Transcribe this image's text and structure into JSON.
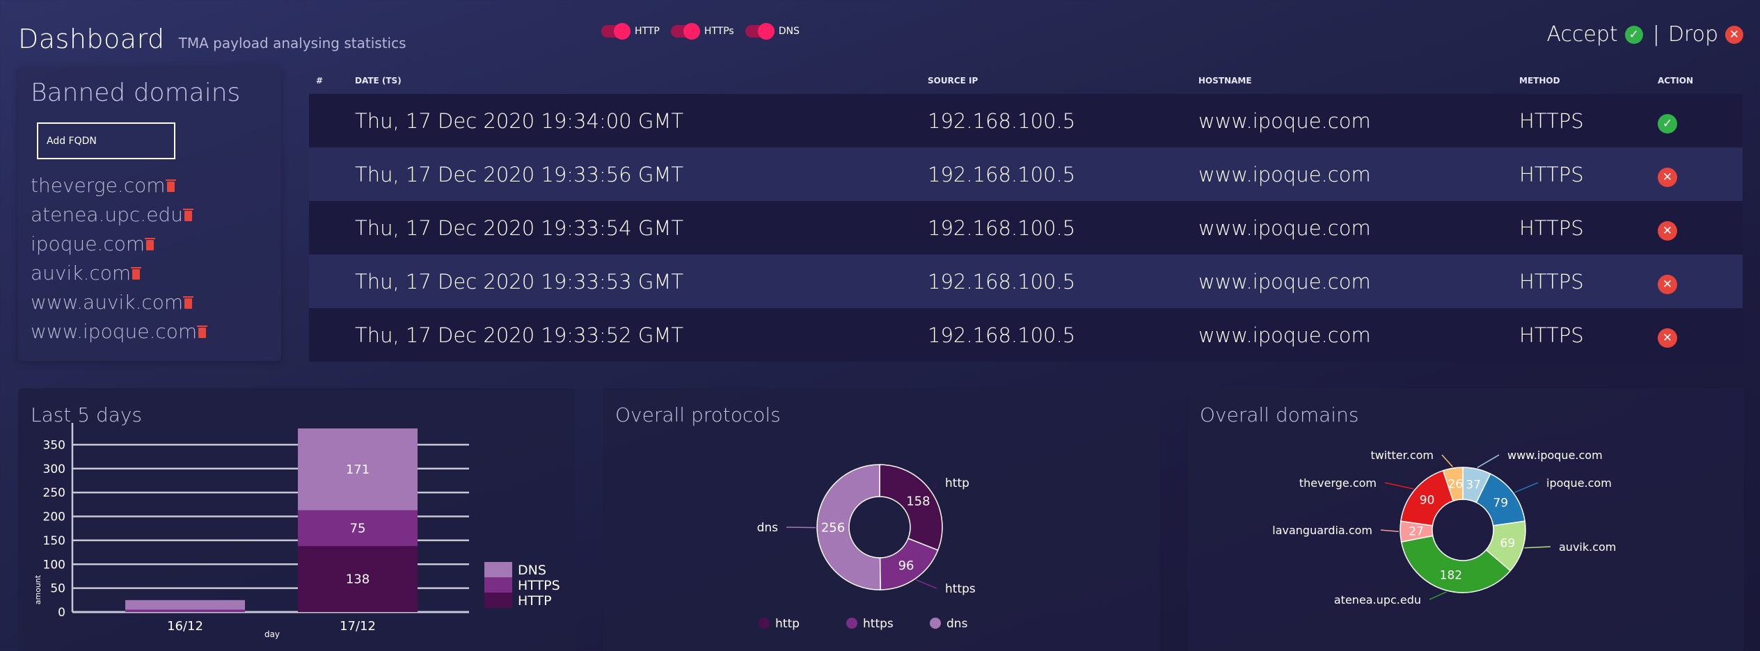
{
  "header": {
    "title": "Dashboard",
    "subtitle": "TMA payload analysing statistics"
  },
  "filters": [
    {
      "label": "HTTP",
      "on": true
    },
    {
      "label": "HTTPs",
      "on": true
    },
    {
      "label": "DNS",
      "on": true
    }
  ],
  "legend": {
    "accept_label": "Accept",
    "separator": "|",
    "drop_label": "Drop"
  },
  "banned": {
    "title": "Banned domains",
    "add_button": "Add FQDN",
    "domains": [
      "theverge.com",
      "atenea.upc.edu",
      "ipoque.com",
      "auvik.com",
      "www.auvik.com",
      "www.ipoque.com"
    ]
  },
  "table": {
    "headers": [
      "#",
      "DATE (TS)",
      "SOURCE IP",
      "HOSTNAME",
      "METHOD",
      "ACTION"
    ],
    "rows": [
      {
        "date": "Thu, 17 Dec 2020 19:34:00 GMT",
        "ip": "192.168.100.5",
        "host": "www.ipoque.com",
        "method": "HTTPS",
        "action": "accept"
      },
      {
        "date": "Thu, 17 Dec 2020 19:33:56 GMT",
        "ip": "192.168.100.5",
        "host": "www.ipoque.com",
        "method": "HTTPS",
        "action": "drop"
      },
      {
        "date": "Thu, 17 Dec 2020 19:33:54 GMT",
        "ip": "192.168.100.5",
        "host": "www.ipoque.com",
        "method": "HTTPS",
        "action": "drop"
      },
      {
        "date": "Thu, 17 Dec 2020 19:33:53 GMT",
        "ip": "192.168.100.5",
        "host": "www.ipoque.com",
        "method": "HTTPS",
        "action": "drop"
      },
      {
        "date": "Thu, 17 Dec 2020 19:33:52 GMT",
        "ip": "192.168.100.5",
        "host": "www.ipoque.com",
        "method": "HTTPS",
        "action": "drop"
      }
    ]
  },
  "panels": {
    "days_title": "Last 5 days",
    "protocols_title": "Overall protocols",
    "domains_title": "Overall domains"
  },
  "colors": {
    "accept": "#33b249",
    "drop": "#e8453c",
    "toggle": "#ff1f67"
  },
  "chart_data": [
    {
      "type": "bar",
      "stacked": true,
      "categories": [
        "16/12",
        "17/12"
      ],
      "series": [
        {
          "name": "HTTP",
          "values": [
            0,
            138
          ],
          "color": "#4a0f4d"
        },
        {
          "name": "HTTPS",
          "values": [
            5,
            75
          ],
          "color": "#7a2e86"
        },
        {
          "name": "DNS",
          "values": [
            20,
            171
          ],
          "color": "#a478b4"
        }
      ],
      "xlabel": "day",
      "ylabel": "amount",
      "yticks": [
        0,
        50,
        100,
        150,
        200,
        250,
        300,
        350
      ],
      "ylim": [
        0,
        384
      ],
      "grid": true,
      "legend": "right"
    },
    {
      "type": "pie",
      "donut": true,
      "labels": [
        "http",
        "https",
        "dns"
      ],
      "values": [
        158,
        96,
        256
      ],
      "colors": [
        "#4a0f4d",
        "#7a2e86",
        "#a478b4"
      ],
      "legend": "bottom"
    },
    {
      "type": "pie",
      "donut": true,
      "labels": [
        "www.ipoque.com",
        "ipoque.com",
        "auvik.com",
        "atenea.upc.edu",
        "lavanguardia.com",
        "theverge.com",
        "twitter.com"
      ],
      "values": [
        37,
        79,
        69,
        182,
        27,
        90,
        26
      ],
      "colors": [
        "#a6cee3",
        "#1f78b4",
        "#b2df8a",
        "#33a02c",
        "#fb9a99",
        "#e31a1c",
        "#fdbf6f"
      ]
    }
  ]
}
